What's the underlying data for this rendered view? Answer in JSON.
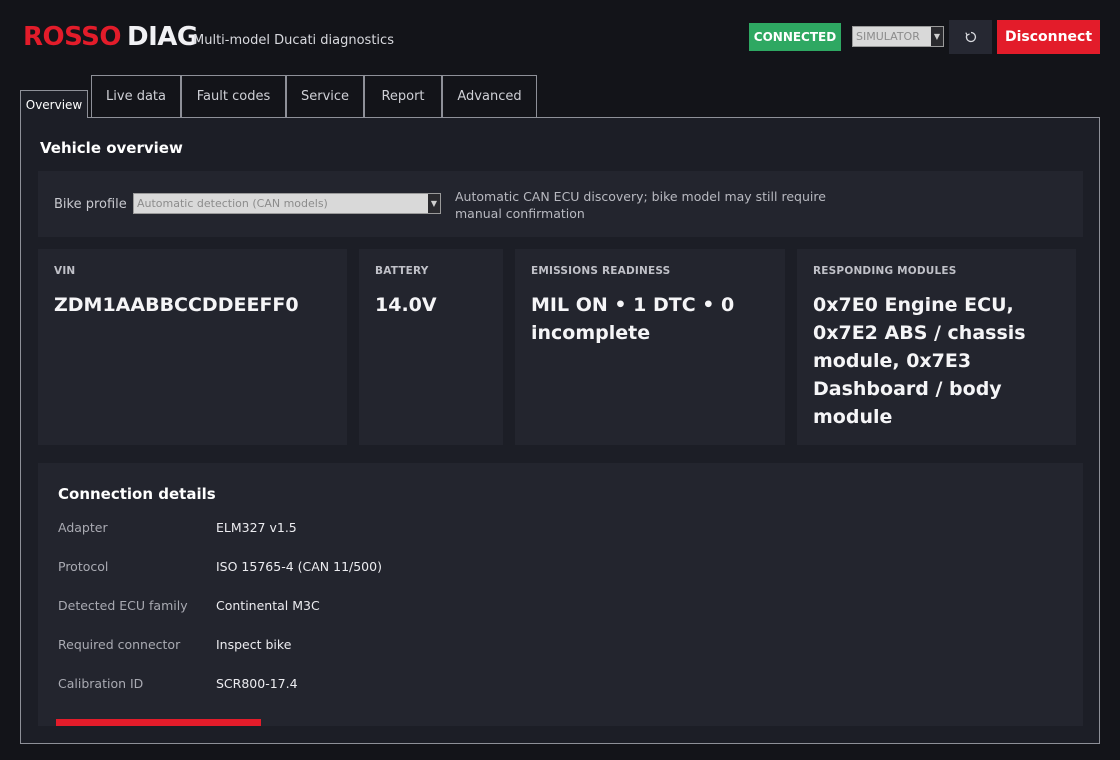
{
  "app": {
    "logo_red": "ROSSO",
    "logo_white": "DIAG",
    "subtitle": "Multi-model Ducati diagnostics",
    "status": "CONNECTED",
    "mode": "SIMULATOR",
    "refresh_icon": "refresh-icon",
    "disconnect_label": "Disconnect",
    "accent": "#e31c2a",
    "status_color": "#2ea862"
  },
  "tabs": [
    {
      "label": "Overview",
      "active": true
    },
    {
      "label": "Live data"
    },
    {
      "label": "Fault codes"
    },
    {
      "label": "Service"
    },
    {
      "label": "Report"
    },
    {
      "label": "Advanced"
    }
  ],
  "overview": {
    "title": "Vehicle overview",
    "profile_label": "Bike profile",
    "profile_value": "Automatic detection (CAN models)",
    "profile_note": "Automatic CAN ECU discovery; bike model may still require manual confirmation"
  },
  "cards": [
    {
      "label": "VIN",
      "value": "ZDM1AABBCCDDEEFF0"
    },
    {
      "label": "BATTERY",
      "value": "14.0V"
    },
    {
      "label": "EMISSIONS READINESS",
      "value": "MIL ON • 1 DTC • 0 incomplete"
    },
    {
      "label": "RESPONDING MODULES",
      "value": "0x7E0 Engine ECU, 0x7E2 ABS / chassis module, 0x7E3 Dashboard / body module"
    }
  ],
  "connection": {
    "title": "Connection details",
    "rows": [
      {
        "k": "Adapter",
        "v": "ELM327 v1.5"
      },
      {
        "k": "Protocol",
        "v": "ISO 15765-4 (CAN 11/500)"
      },
      {
        "k": "Detected ECU family",
        "v": "Continental M3C"
      },
      {
        "k": "Required connector",
        "v": "Inspect bike"
      },
      {
        "k": "Calibration ID",
        "v": "SCR800-17.4"
      }
    ]
  }
}
